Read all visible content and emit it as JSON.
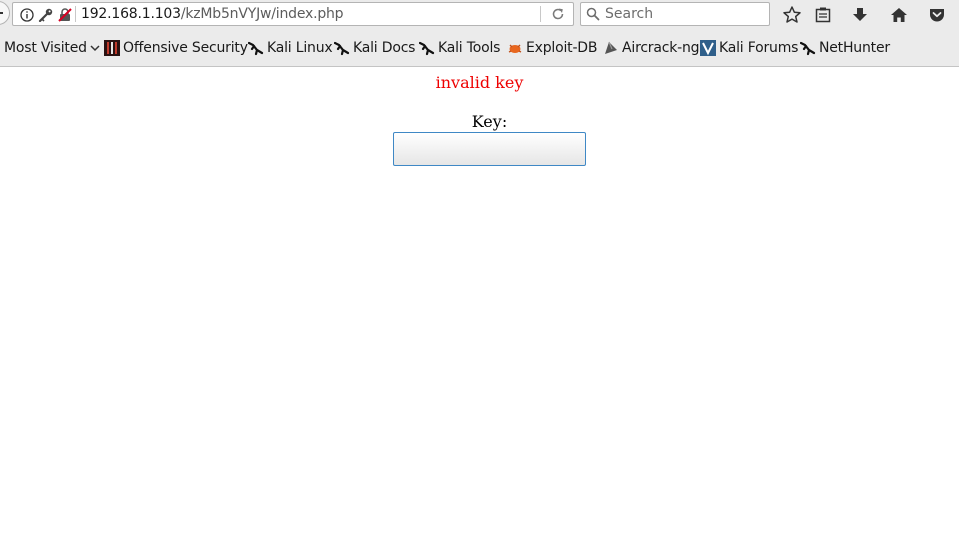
{
  "urlbar": {
    "host": "192.168.1.103",
    "path": "/kzMb5nVYJw/index.php"
  },
  "search": {
    "placeholder": "Search"
  },
  "bookmarks": [
    {
      "label": "Most Visited"
    },
    {
      "label": "Offensive Security"
    },
    {
      "label": "Kali Linux"
    },
    {
      "label": "Kali Docs"
    },
    {
      "label": "Kali Tools"
    },
    {
      "label": "Exploit-DB"
    },
    {
      "label": "Aircrack-ng"
    },
    {
      "label": "Kali Forums"
    },
    {
      "label": "NetHunter"
    }
  ],
  "page": {
    "error": "invalid key",
    "key_label": "Key:",
    "key_value": ""
  },
  "colors": {
    "error": "#ee0000",
    "input_border": "#3f88c5",
    "toolbar": "#ebebeb"
  }
}
